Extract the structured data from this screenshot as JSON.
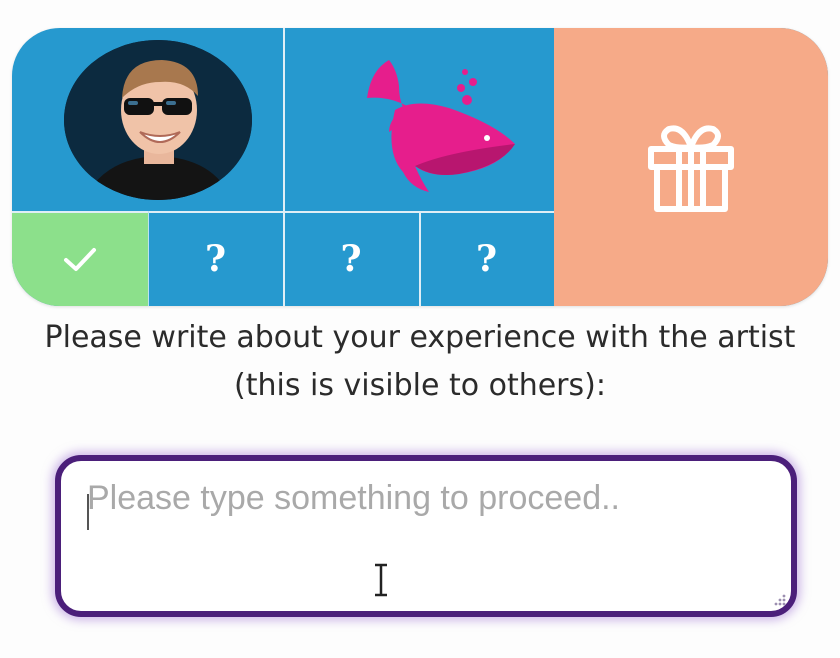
{
  "card": {
    "colors": {
      "blue": "#2699cf",
      "green": "#8ce08b",
      "peach": "#f6aa88",
      "whale_pink": "#e61e8c"
    },
    "avatar_icon": "person-avatar-photo",
    "logo_icon": "whale-logo-icon",
    "gift_icon": "gift-icon",
    "steps": [
      {
        "icon": "checkmark-icon",
        "state": "done"
      },
      {
        "label": "?",
        "state": "locked"
      },
      {
        "label": "?",
        "state": "locked"
      },
      {
        "label": "?",
        "state": "locked"
      }
    ]
  },
  "prompt": {
    "line1": "Please write about your experience with the artist",
    "line2": "(this is visible to others):"
  },
  "review": {
    "placeholder": "Please type something to proceed..",
    "value": "",
    "border_color": "#4b1f7a"
  }
}
